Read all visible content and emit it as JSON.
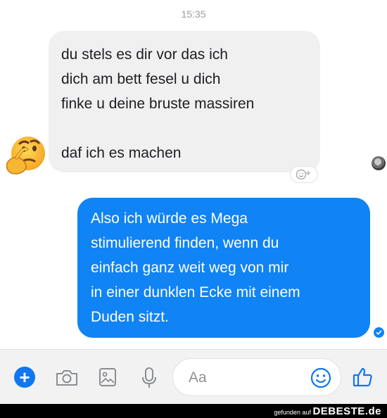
{
  "timestamp": "15:35",
  "incoming": {
    "lines": [
      "du stels es dir vor das ich",
      "dich am bett fesel u dich",
      "finke u deine bruste massiren",
      "daf ich es machen"
    ],
    "reaction_emoji": "thinking-face"
  },
  "outgoing": {
    "lines": [
      "Also ich würde es Mega",
      "stimulierend finden, wenn du",
      "einfach ganz weit weg von mir",
      "in einer dunklen Ecke mit einem",
      "Duden sitzt."
    ],
    "accent": "#1083f5"
  },
  "composer": {
    "placeholder": "Aa",
    "icons": [
      "plus-icon",
      "camera-icon",
      "image-icon",
      "microphone-icon",
      "emoji-icon",
      "thumbs-up-icon"
    ],
    "accent": "#1077f0"
  },
  "footer": {
    "prefix": "gefunden auf",
    "brand": "DEBESTE.de"
  }
}
